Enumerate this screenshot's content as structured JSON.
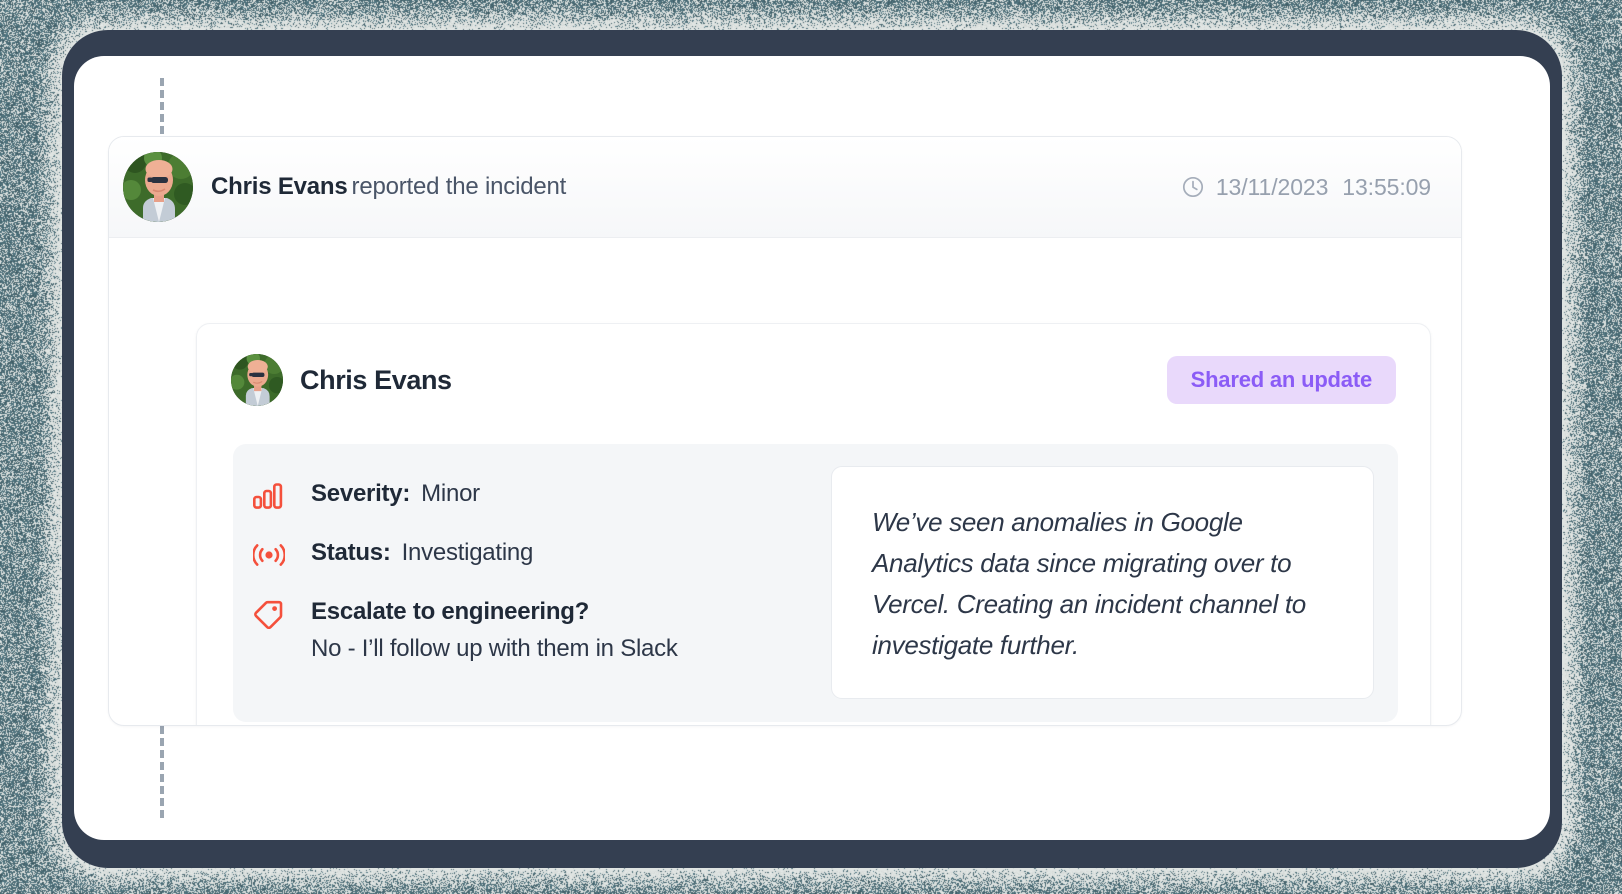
{
  "theme": {
    "frame_color": "#343f51",
    "backdrop_color": "#dfe4e2",
    "backdrop_noise_color": "#4a6b75",
    "accent_red": "#f4503c",
    "badge_bg": "#e9d9fb",
    "badge_fg": "#8b5cf6",
    "text_primary": "#1f2937",
    "text_secondary": "#4a5568",
    "text_muted": "#97a0ae",
    "panel_bg": "#f4f6f8",
    "card_bg": "#ffffff"
  },
  "event": {
    "actor": "Chris Evans",
    "action": "reported the incident",
    "date": "13/11/2023",
    "time": "13:55:09",
    "clock_icon": "clock-icon",
    "avatar_icon": "avatar-chris-evans"
  },
  "update": {
    "author": "Chris Evans",
    "avatar_icon": "avatar-chris-evans",
    "badge": "Shared an update",
    "fields": [
      {
        "icon": "severity-bars-icon",
        "label": "Severity:",
        "value": "Minor",
        "answer": ""
      },
      {
        "icon": "status-broadcast-icon",
        "label": "Status:",
        "value": "Investigating",
        "answer": ""
      },
      {
        "icon": "tag-icon",
        "label": "Escalate to engineering?",
        "value": "",
        "answer": "No - I’ll follow up with them in Slack"
      }
    ],
    "quote": "We’ve seen anomalies in Google Analytics data since migrating over to Vercel. Creating an incident channel to investigate further."
  }
}
